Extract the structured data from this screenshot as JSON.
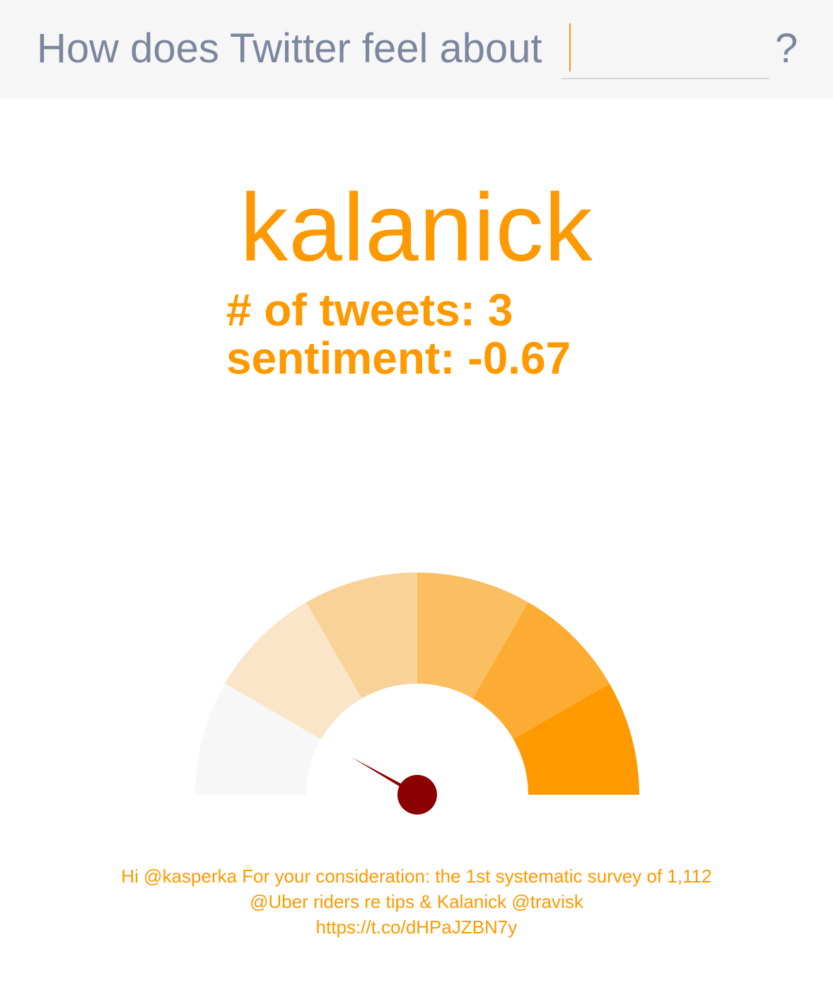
{
  "search": {
    "prompt": "How does Twitter feel about",
    "value": "",
    "placeholder": "",
    "suffix": "?"
  },
  "result": {
    "term": "kalanick",
    "tweet_count_label": "# of tweets: 3",
    "sentiment_label": "sentiment: -0.67",
    "tweet_count": 3,
    "sentiment": -0.67
  },
  "gauge": {
    "min": -1,
    "max": 1,
    "value": -0.67,
    "segment_colors": [
      "#f7f7f7",
      "#fae5c8",
      "#f8d299",
      "#fbbf61",
      "#fcac33",
      "#ff9900"
    ],
    "needle_color": "#8b0000"
  },
  "tweet": {
    "text": "Hi @kasperka For your consideration: the 1st systematic survey of 1,112 @Uber riders re tips & Kalanick @travisk",
    "link": "https://t.co/dHPaJZBN7y"
  },
  "colors": {
    "accent": "#ff9900",
    "prompt_text": "#7c869d",
    "header_bg": "#f6f6f6"
  }
}
